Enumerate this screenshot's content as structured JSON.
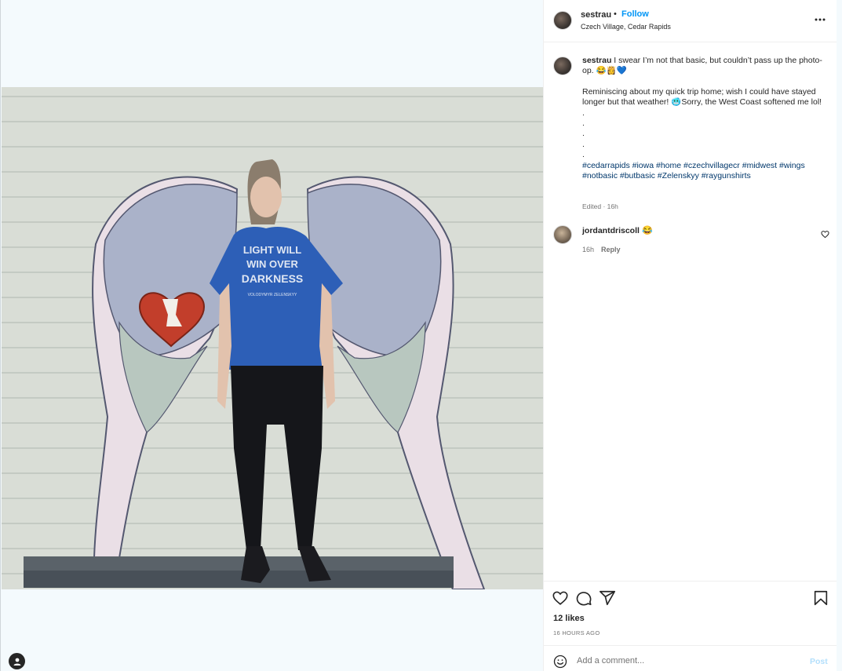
{
  "post": {
    "username": "sestrau",
    "separator": "•",
    "follow_label": "Follow",
    "location": "Czech Village, Cedar Rapids",
    "photo": {
      "shirt_line1": "LIGHT WILL",
      "shirt_line2": "WIN OVER",
      "shirt_line3": "DARKNESS",
      "shirt_line4": "VOLODYMYR ZELENSKYY"
    }
  },
  "caption": {
    "username": "sestrau",
    "line1": " I swear I’m not that basic, but couldn’t pass up the photo-op. 😂👸💙",
    "paragraph2": "Reminiscing about my quick trip home; wish I could have stayed longer but that weather! 🥶Sorry, the West Coast softened me lol!",
    "dots": [
      ".",
      ".",
      ".",
      ".",
      "."
    ],
    "hashtags": [
      "#cedarrapids",
      "#iowa",
      "#home",
      "#czechvillagecr",
      "#midwest",
      "#wings",
      "#notbasic",
      "#butbasic",
      "#Zelenskyy",
      "#raygunshirts"
    ],
    "edited": "Edited · 16h"
  },
  "comment": {
    "username": "jordantdriscoll",
    "text": "😂",
    "time": "16h",
    "reply_label": "Reply"
  },
  "footer": {
    "likes": "12 likes",
    "ago": "16 HOURS AGO",
    "comment_placeholder": "Add a comment...",
    "post_label": "Post"
  },
  "icons": {
    "like": "heart-icon",
    "comment": "comment-icon",
    "share": "share-icon",
    "save": "bookmark-icon",
    "more": "more-icon",
    "emoji": "smile-icon",
    "tag": "user-tag-icon"
  },
  "colors": {
    "link_blue": "#0095f6",
    "hashtag": "#00376b",
    "post_disabled": "#b2dffc",
    "media_bg": "#f4fafd"
  }
}
